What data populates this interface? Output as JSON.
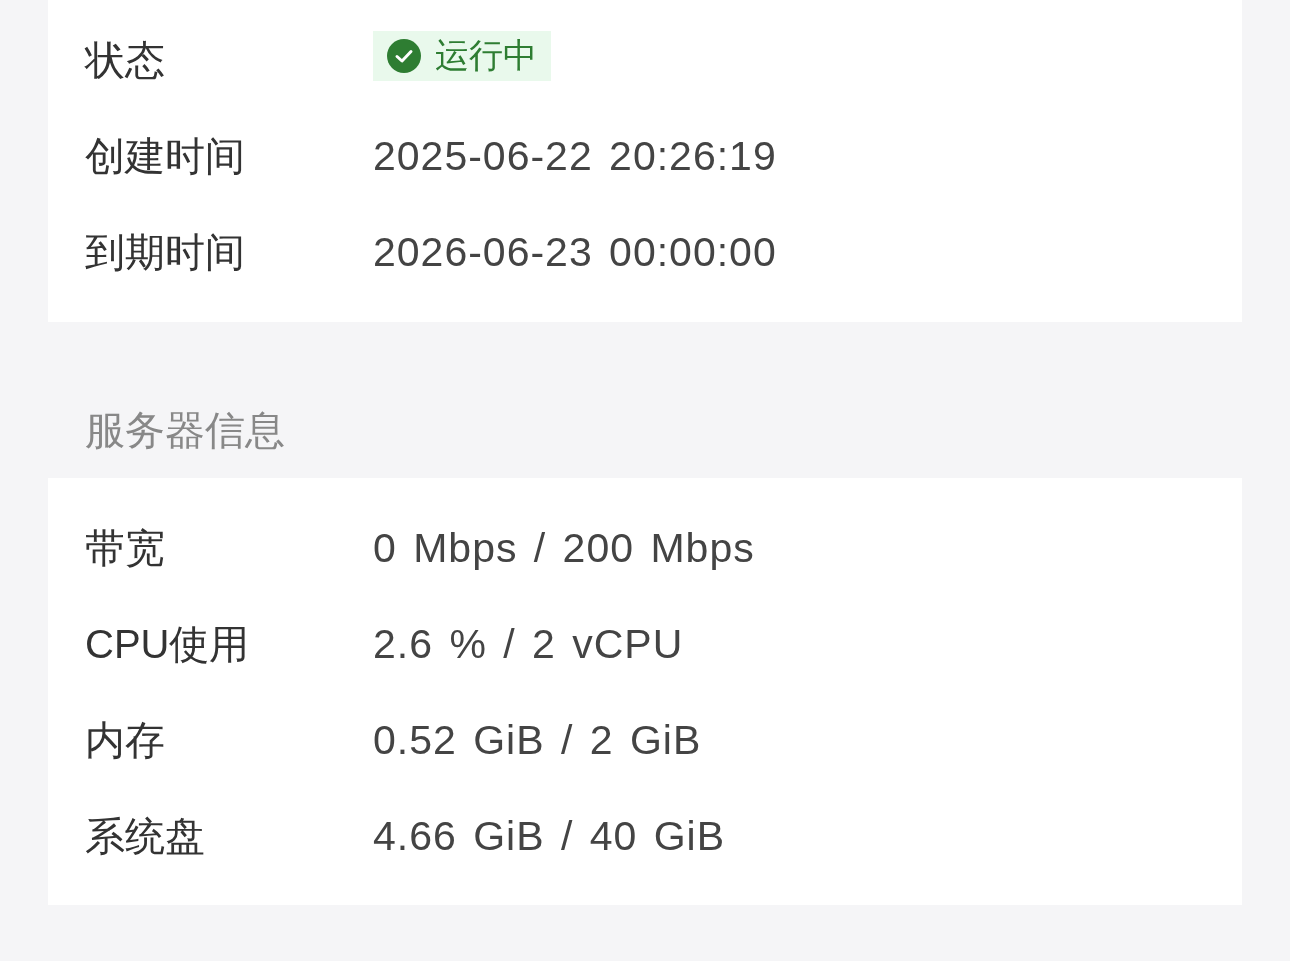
{
  "sections": [
    {
      "rows": [
        {
          "kind": "status",
          "label": "状态",
          "value": "运行中"
        },
        {
          "kind": "text",
          "label": "创建时间",
          "value": "2025-06-22 20:26:19"
        },
        {
          "kind": "text",
          "label": "到期时间",
          "value": "2026-06-23 00:00:00"
        }
      ]
    },
    {
      "title": "服务器信息",
      "rows": [
        {
          "kind": "text",
          "label": "带宽",
          "value": "0 Mbps / 200 Mbps"
        },
        {
          "kind": "text",
          "label": "CPU使用",
          "value": "2.6 % / 2 vCPU"
        },
        {
          "kind": "text",
          "label": "内存",
          "value": "0.52 GiB / 2 GiB"
        },
        {
          "kind": "text",
          "label": "系统盘",
          "value": "4.66 GiB / 40 GiB"
        }
      ]
    }
  ]
}
